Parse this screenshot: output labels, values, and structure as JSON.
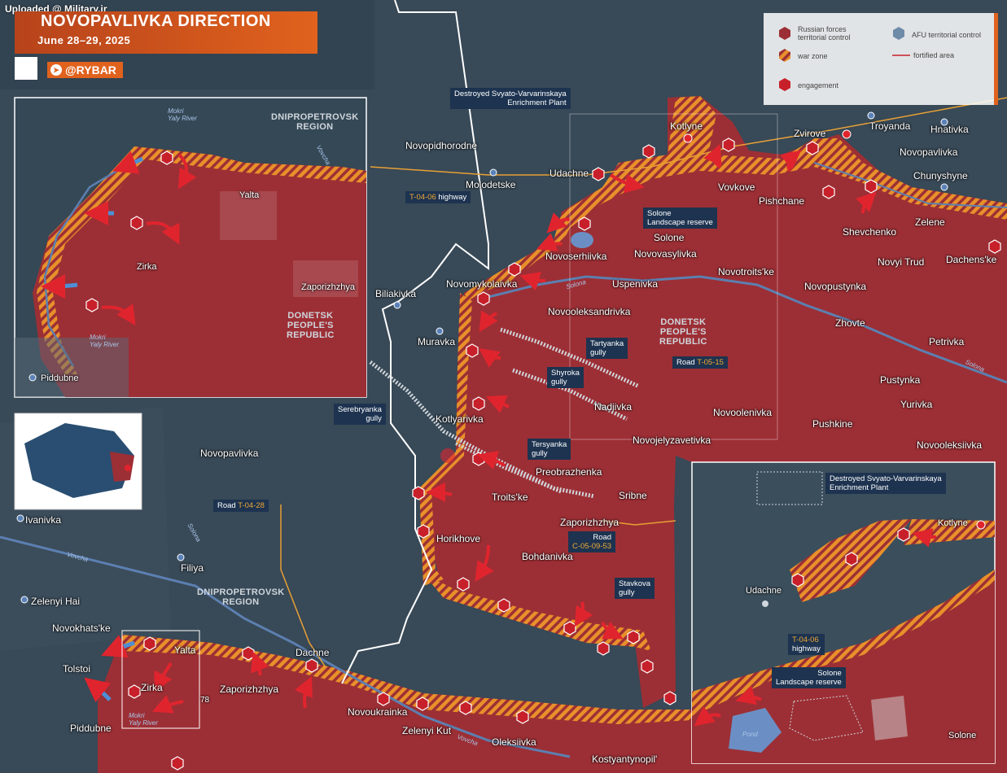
{
  "header": {
    "uploaded": "Uploaded @ Military.ir",
    "title": "NOVOPAVLIVKA DIRECTION",
    "date": "June 28–29, 2025",
    "brand": "@RYBAR"
  },
  "legend": {
    "russian": "Russian forces\nterritorial control",
    "afu": "AFU territorial control",
    "war_zone": "war zone",
    "fortified": "fortified area",
    "engagement": "engagement"
  },
  "colors": {
    "russian": "#9c2f35",
    "afu_bg": "#34485a",
    "war_zone": "#e8902a",
    "accent": "#e0621d",
    "callout": "#1d3350",
    "engagement": "#c8202a"
  },
  "settlements": {
    "main": [
      "Novopidhorodne",
      "Molodetske",
      "Udachne",
      "Kotlyne",
      "Zvirove",
      "Troyanda",
      "Hnativka",
      "Novopavlivka",
      "Chunyshyne",
      "Vovkove",
      "Pishchane",
      "Zelene",
      "Solone",
      "Shevchenko",
      "Dachens'ke",
      "Novoserhiivka",
      "Novovasylivka",
      "Novyi Trud",
      "Novomykolaivka",
      "Uspenivka",
      "Novotroits'ke",
      "Novopustynka",
      "Biliakivka",
      "Novooleksandrivka",
      "Zhovte",
      "Muravka",
      "Petrivka",
      "Pustynka",
      "Nadiivka",
      "Yurivka",
      "Kotlyarivka",
      "Novoolenivka",
      "Pushkine",
      "Novojelyzavetivka",
      "Novooleksiivka",
      "Preobrazhenka",
      "Troits'ke",
      "Sribne",
      "Zaporizhzhya",
      "Horikhove",
      "Bohdanivka",
      "Novopavlivka",
      "Ivanivka",
      "Filiya",
      "Zelenyi Hai",
      "Novokhats'ke",
      "Yalta",
      "Tolstoi",
      "Zirka",
      "Zaporizhzhya",
      "Dachne",
      "Piddubne",
      "Novoukrainka",
      "Zelenyi Kut",
      "Oleksiivka",
      "Kostyantynopil'"
    ],
    "inset_left": [
      "Yalta",
      "Zirka",
      "Zaporizhzhya",
      "Piddubne"
    ],
    "inset_right": [
      "Udachne",
      "Kotlyne",
      "Solone"
    ]
  },
  "regions": {
    "dnipro_top": "DNIPROPETROVSK\nREGION",
    "donetsk_inset": "DONETSK\nPEOPLE'S\nREPUBLIC",
    "donetsk_main": "DONETSK\nPEOPLE'S\nREPUBLIC",
    "dnipro_bottom": "DNIPROPETROVSK\nREGION"
  },
  "callouts": {
    "enrichment_top": "Destroyed Svyato-Varvarinskaya\nEnrichment Plant",
    "t0406": "T-04-06",
    "t0406_suffix": " highway",
    "solone_reserve": "Solone\nLandscape reserve",
    "tartyanka": "Tartyanka\ngully",
    "shyroka": "Shyroka\ngully",
    "road_t0515": "Road ",
    "road_t0515_code": "T-05-15",
    "serebryanka": "Serebryanka\ngully",
    "tersyanka": "Tersyanka\ngully",
    "road_t0428": "Road ",
    "road_t0428_code": "T-04-28",
    "road_c050953": "Road",
    "road_c050953_code": "C-05-09-53",
    "stavkova": "Stavkova\ngully",
    "enrichment_inset": "Destroyed Svyato-Varvarinskaya\nEnrichment Plant",
    "t0406_inset": "T-04-06",
    "t0406_inset_suffix": "highway",
    "solone_reserve_inset": "Solone\nLandscape reserve"
  },
  "rivers": [
    "Mokri\nYaly River",
    "Vovcha",
    "Solona",
    "Solona",
    "Solona",
    "Vovcha",
    "Mokri\nYaly River",
    "Vovcha",
    "Mokri\nYaly River",
    "Pond"
  ],
  "markers": {
    "height_label": "78"
  }
}
